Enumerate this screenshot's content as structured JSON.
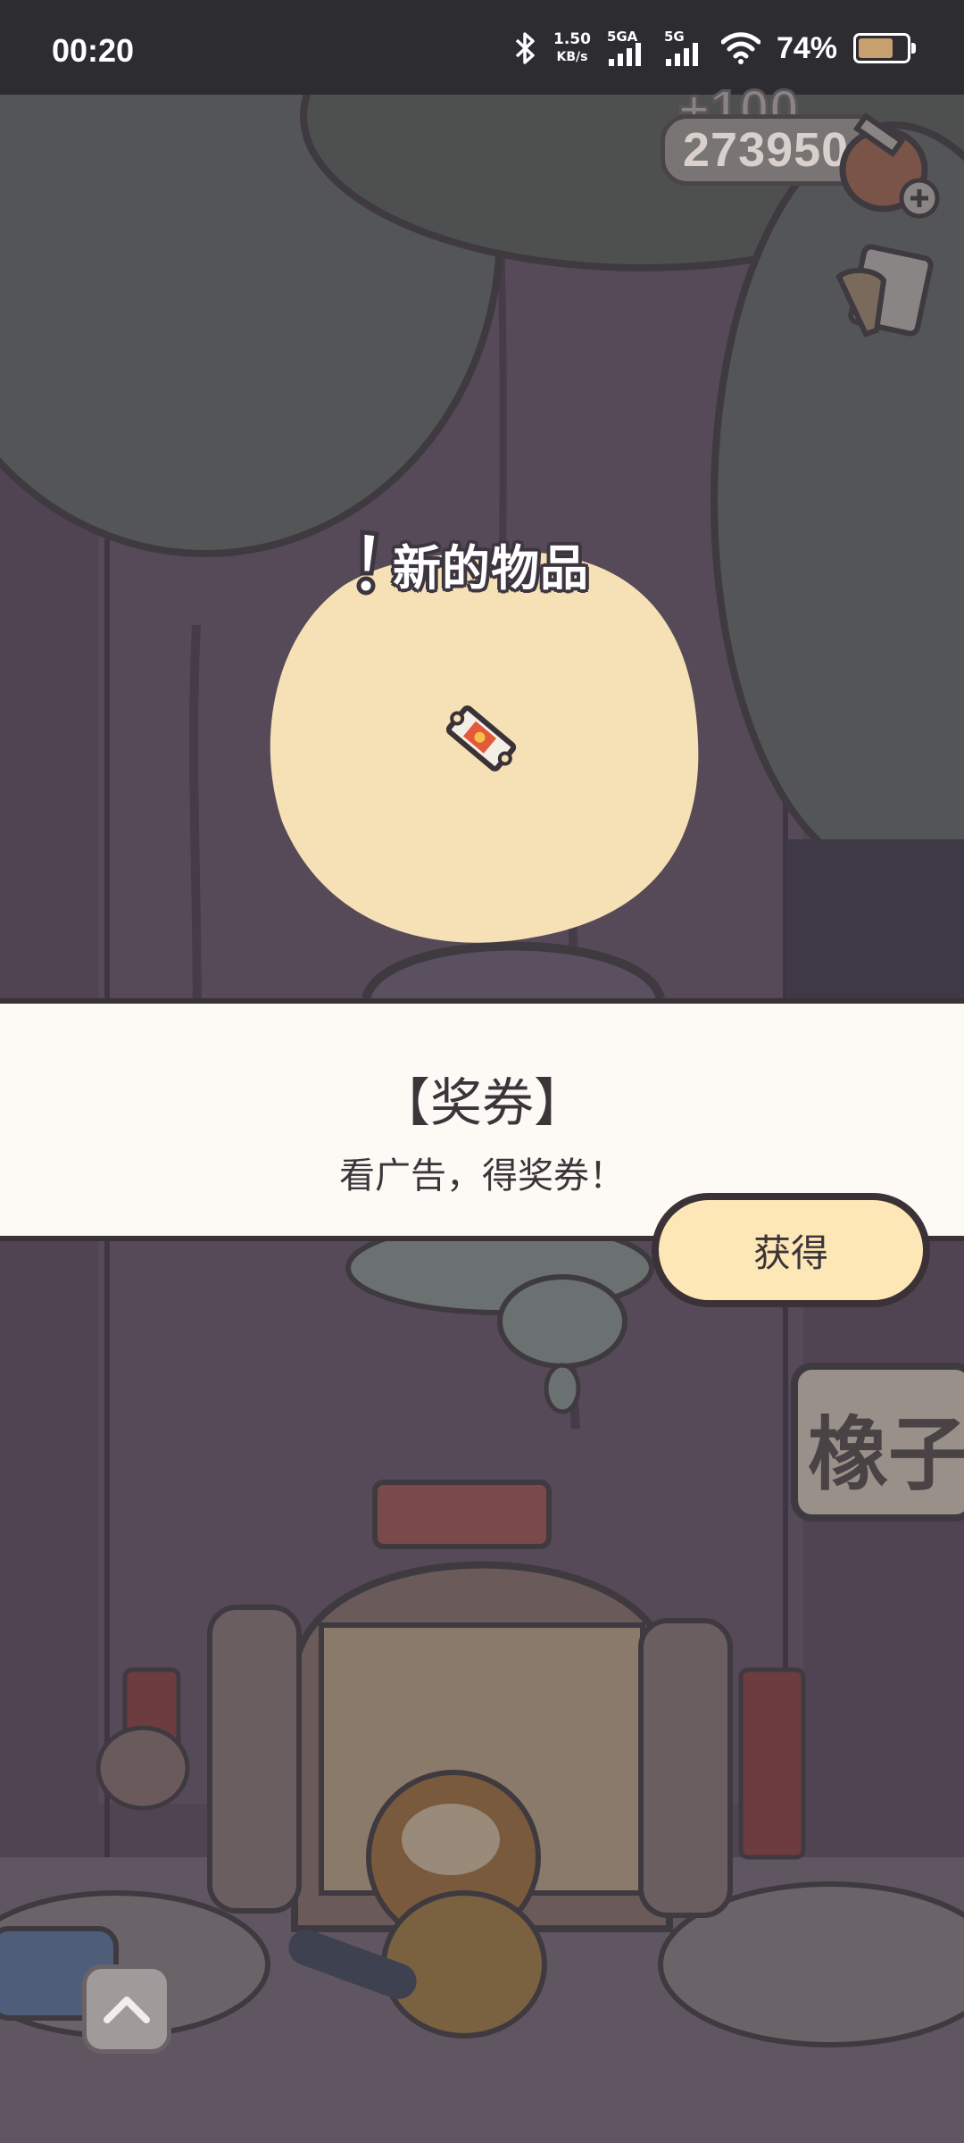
{
  "status_bar": {
    "time": "00:20",
    "net_speed_value": "1.50",
    "net_speed_unit": "KB/s",
    "sim1_label": "5GA",
    "sim2_label": "5G",
    "battery_percent": "74%",
    "battery_level": 0.74
  },
  "hud": {
    "coin_gain": "+100",
    "coin_total": "273950"
  },
  "reward": {
    "title": "新的物品",
    "item_name": "【奖券】",
    "item_description": "看广告，得奖券！",
    "get_button_label": "获得"
  },
  "scene": {
    "shop_sign_text": "橡子"
  },
  "colors": {
    "status_bar_bg": "#2d2c30",
    "spotlight": "#f5e1b5",
    "panel_bg": "#fdfaf6",
    "button_bg": "#fde7b7",
    "outline": "#3a3237"
  },
  "icons": [
    "bluetooth-icon",
    "wifi-icon",
    "battery-icon",
    "acorn-add-icon",
    "clipboard-icon",
    "ticket-icon",
    "chevron-up-icon"
  ]
}
